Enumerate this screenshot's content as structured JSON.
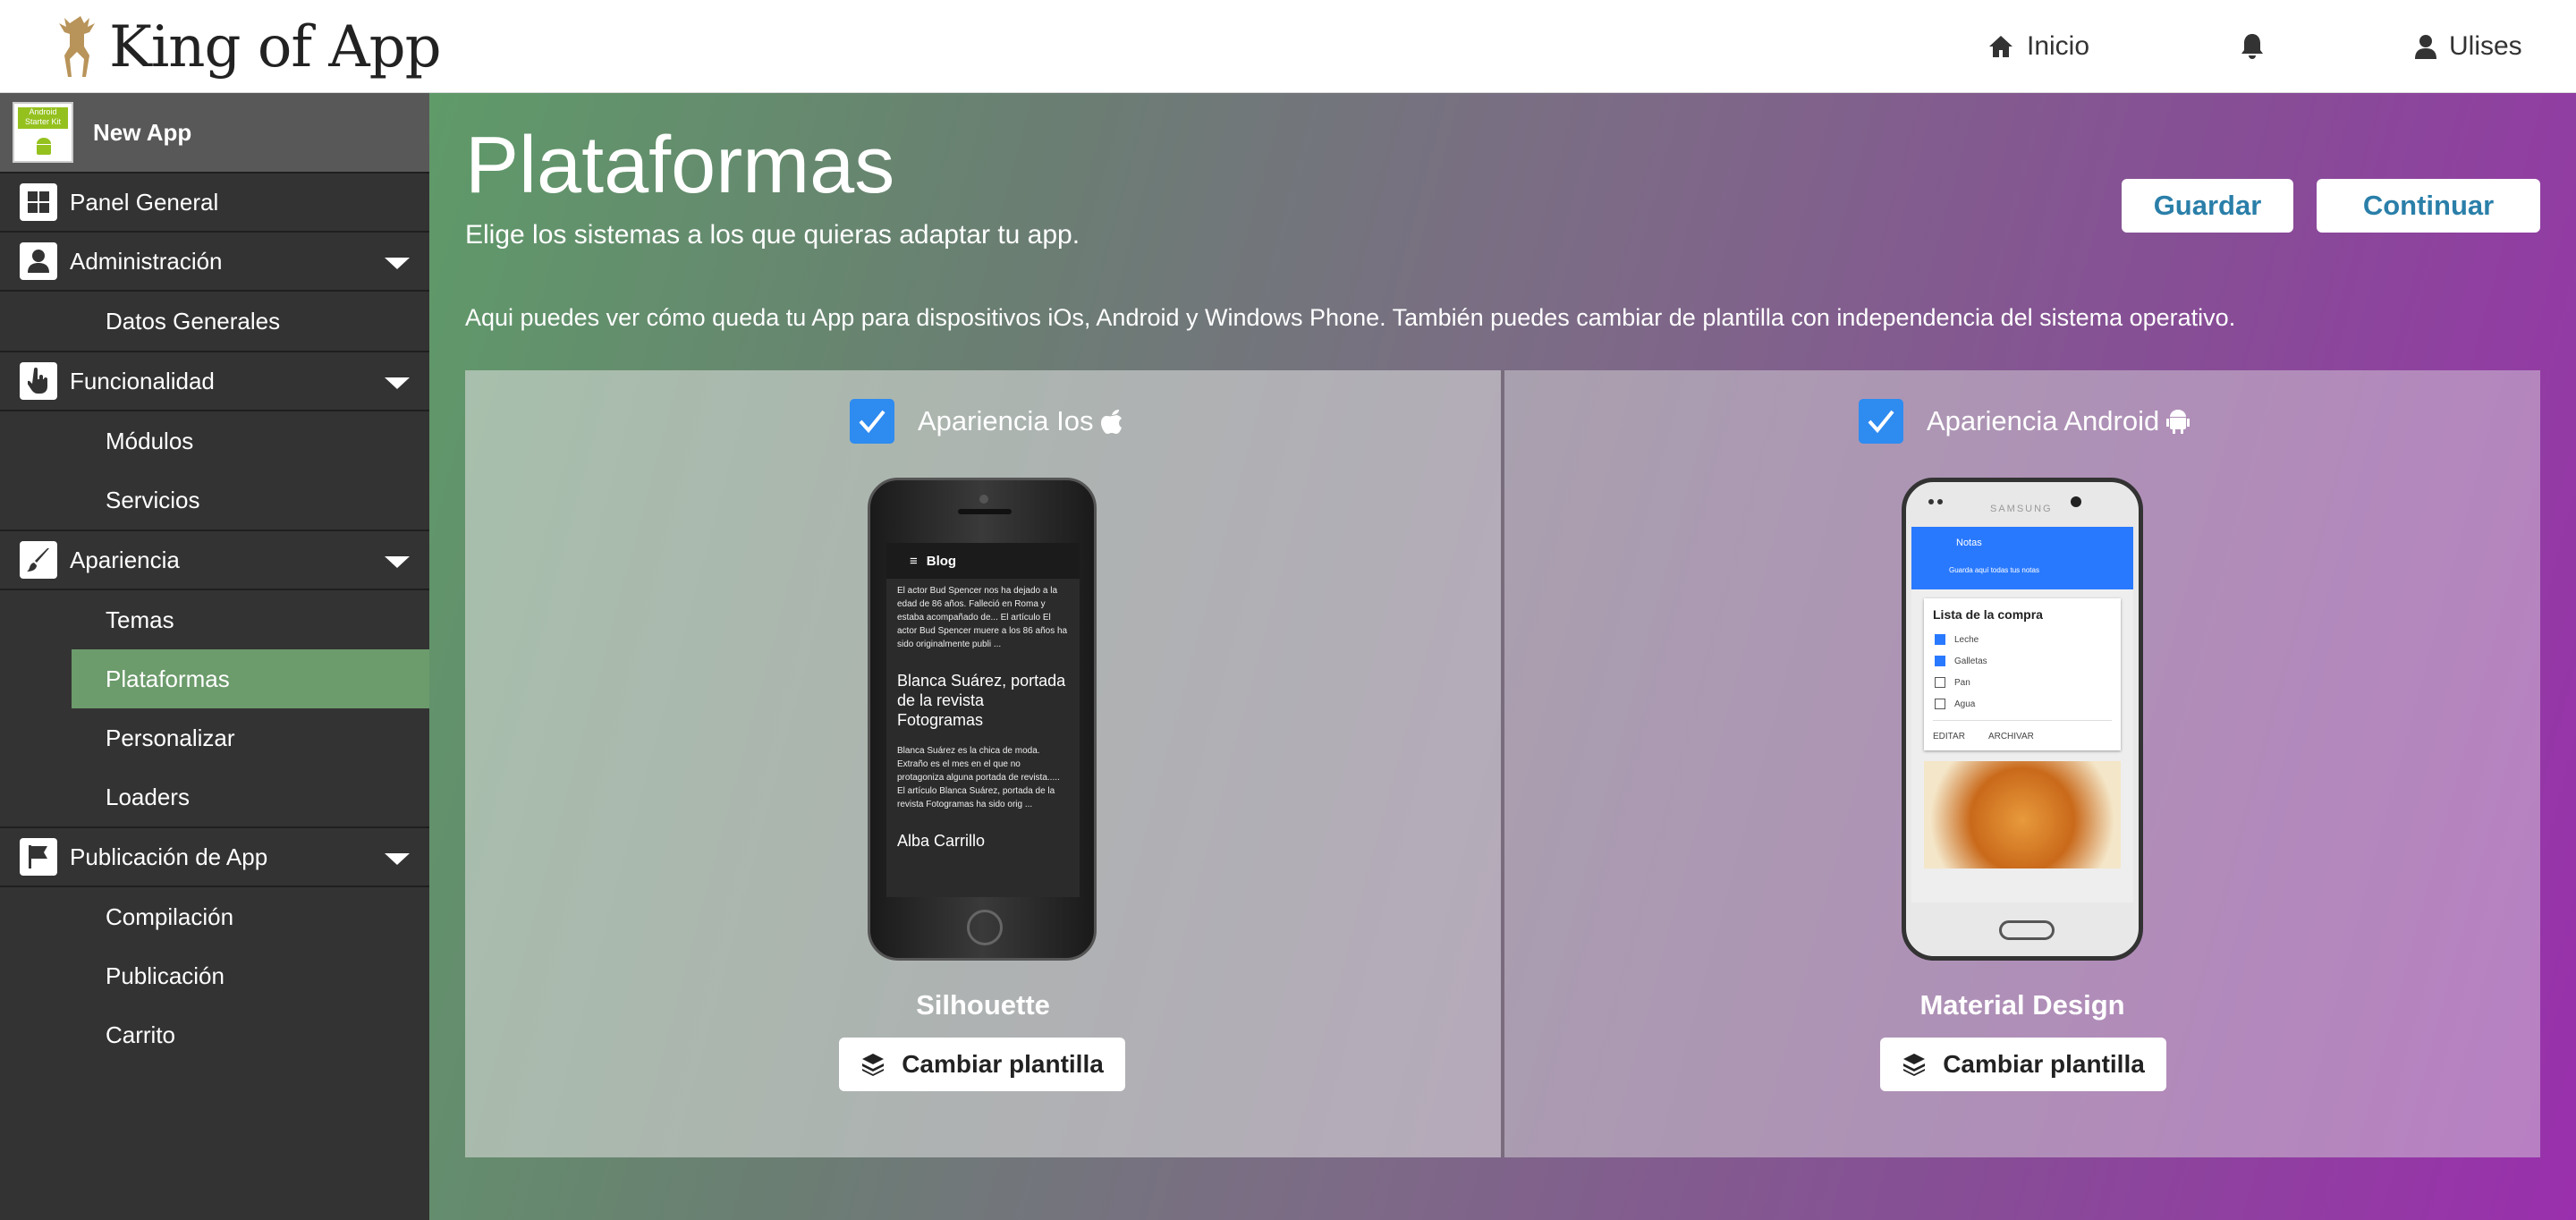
{
  "header": {
    "logo_text": "King of App",
    "nav": {
      "home": "Inicio",
      "user": "Ulises"
    }
  },
  "sidebar": {
    "app": {
      "name": "New App",
      "thumb_text": "Android Starter Kit"
    },
    "panel_general": "Panel General",
    "sections": [
      {
        "label": "Administración",
        "items": [
          "Datos Generales"
        ]
      },
      {
        "label": "Funcionalidad",
        "items": [
          "Módulos",
          "Servicios"
        ]
      },
      {
        "label": "Apariencia",
        "items": [
          "Temas",
          "Plataformas",
          "Personalizar",
          "Loaders"
        ]
      },
      {
        "label": "Publicación de App",
        "items": [
          "Compilación",
          "Publicación",
          "Carrito"
        ]
      }
    ],
    "active_item": "Plataformas"
  },
  "main": {
    "title": "Plataformas",
    "subtitle": "Elige los sistemas a los que quieras adaptar tu app.",
    "description": "Aqui puedes ver cómo queda tu App para dispositivos iOs, Android y Windows Phone. También puedes cambiar de plantilla con independencia del sistema operativo.",
    "buttons": {
      "save": "Guardar",
      "continue": "Continuar"
    },
    "platforms": [
      {
        "label": "Apariencia Ios",
        "checked": true,
        "template": "Silhouette",
        "change_button": "Cambiar plantilla",
        "preview": {
          "bar_title": "Blog",
          "para1": "El actor Bud Spencer nos ha dejado a la edad de 86 años. Falleció en Roma y estaba acompañado de... El artículo El actor Bud Spencer muere a los 86 años ha sido originalmente publi ...",
          "heading": "Blanca Suárez, portada de la revista Fotogramas",
          "para2": "Blanca Suárez es la chica de moda. Extraño es el mes en el que no protagoniza alguna portada de revista..... El artículo Blanca Suárez, portada de la revista Fotogramas ha sido orig ...",
          "heading2": "Alba Carrillo"
        }
      },
      {
        "label": "Apariencia Android",
        "checked": true,
        "template": "Material Design",
        "change_button": "Cambiar plantilla",
        "preview": {
          "bar_title": "Notas",
          "bar_subtitle": "Guarda aquí todas tus notas",
          "brand": "SAMSUNG",
          "card_title": "Lista de la compra",
          "items": [
            {
              "label": "Leche",
              "checked": true
            },
            {
              "label": "Galletas",
              "checked": true
            },
            {
              "label": "Pan",
              "checked": false
            },
            {
              "label": "Agua",
              "checked": false
            }
          ],
          "actions": [
            "EDITAR",
            "ARCHIVAR"
          ]
        }
      }
    ]
  },
  "colors": {
    "checkbox": "#2e8bf0",
    "accent_text": "#2a7fa9",
    "sidebar_bg": "#333333",
    "active_item": "#6c9b6c"
  }
}
